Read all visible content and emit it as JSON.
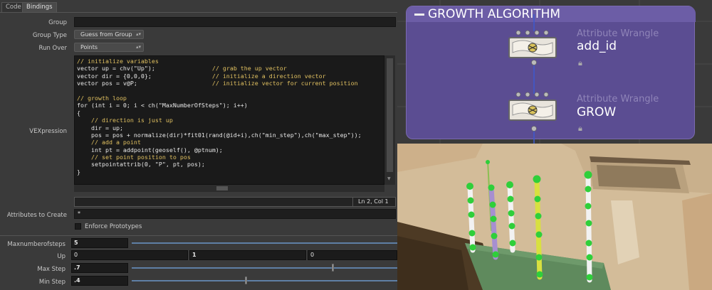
{
  "tabs": [
    "Code",
    "Bindings"
  ],
  "params": {
    "group_label": "Group",
    "group_type_label": "Group Type",
    "group_type_value": "Guess from Group",
    "run_over_label": "Run Over",
    "run_over_value": "Points",
    "vex_label": "VEXpression",
    "status": "Ln 2, Col 1",
    "attributes_label": "Attributes to Create",
    "attributes_value": "*",
    "enforce_label": "Enforce Prototypes",
    "max_steps_label": "Maxnumberofsteps",
    "max_steps_value": "5",
    "up_label": "Up",
    "up_values": [
      "0",
      "1",
      "0"
    ],
    "max_step_label": "Max Step",
    "max_step_value": ".7",
    "min_step_label": "Min Step",
    "min_step_value": ".4"
  },
  "code_lines": [
    {
      "code": "// initialize variables",
      "comment": ""
    },
    {
      "code": "vector up = chv(\"Up\");",
      "comment": "// grab the up vector"
    },
    {
      "code": "vector dir = {0,0,0};",
      "comment": "// initialize a direction vector"
    },
    {
      "code": "vector pos = v@P;",
      "comment": "// initialize vector for current position"
    },
    {
      "code": "",
      "comment": ""
    },
    {
      "code": "// growth loop",
      "comment": ""
    },
    {
      "code": "for (int i = 0; i < ch(\"MaxNumberOfSteps\"); i++)",
      "comment": ""
    },
    {
      "code": "{",
      "comment": ""
    },
    {
      "code": "    // direction is just up",
      "comment": ""
    },
    {
      "code": "    dir = up;",
      "comment": ""
    },
    {
      "code": "    pos = pos + normalize(dir)*fit01(rand(@id+i),ch(\"min_step\"),ch(\"max_step\"));",
      "comment": ""
    },
    {
      "code": "    // add a point",
      "comment": ""
    },
    {
      "code": "    int pt = addpoint(geoself(), @ptnum);",
      "comment": ""
    },
    {
      "code": "    // set point position to pos",
      "comment": ""
    },
    {
      "code": "    setpointattrib(0, \"P\", pt, pos);",
      "comment": ""
    },
    {
      "code": "}",
      "comment": ""
    }
  ],
  "network": {
    "title": "GROWTH ALGORITHM",
    "node1_type": "Attribute Wrangle",
    "node1_name": "add_id",
    "node2_type": "Attribute Wrangle",
    "node2_name": "GROW"
  },
  "colors": {
    "network_box": "#5b4d92",
    "stem_white": "#f2f2f2",
    "stem_purple": "#a78fd0",
    "stem_yellow": "#d8e040",
    "point_green": "#2fcf3a"
  }
}
